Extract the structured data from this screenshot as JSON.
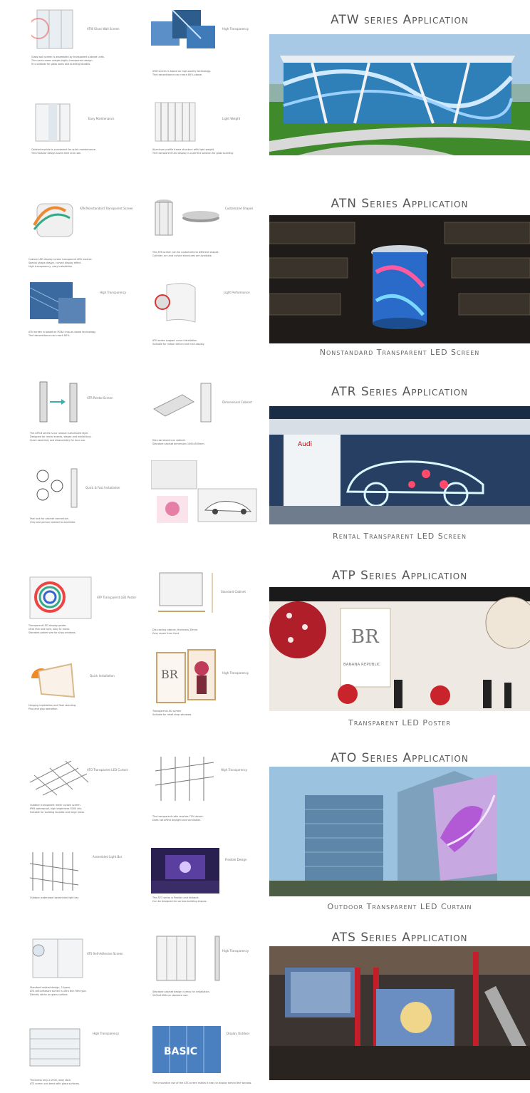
{
  "sections": [
    {
      "id": "atw",
      "title": "ATW series Application",
      "caption": "",
      "features": [
        {
          "tag": "ATW Glass Wall Screen",
          "lines": [
            "Glass wall screen is assembled by transparent cabinet units.",
            "The main screen adopts highly transparent design.",
            "It is suitable for glass walls and building facades."
          ]
        },
        {
          "tag": "High Transparency",
          "lines": [
            "ATW screen is based on high-quality technology.",
            "The transmittance can reach 80% above."
          ]
        },
        {
          "tag": "Easy Maintenance",
          "lines": [
            "Cabinet module is convenient for quick maintenance.",
            "The modular design saves time and cost."
          ]
        },
        {
          "tag": "Light Weight",
          "lines": [
            "Aluminum profile frame structure with light weight.",
            "The transparent LED display is a perfect solution for glass building."
          ]
        }
      ]
    },
    {
      "id": "atn",
      "title": "ATN Series Application",
      "caption": "Nonstandard Transparent LED Screen",
      "features": [
        {
          "tag": "ATN Nonstandard Transparent Screen",
          "lines": [
            "Custom LED display screen transparent LED module.",
            "Special shape design, curved display effect.",
            "High transparency, easy installation."
          ]
        },
        {
          "tag": "Customized Shapes",
          "lines": [
            "The ATN screen can be customized to different shapes.",
            "Cylinder, arc and curved structures are available."
          ]
        },
        {
          "tag": "High Transparency",
          "lines": [
            "ATN screen is based on PCBA chip-on-board technology.",
            "The transmittance can reach 80%."
          ]
        },
        {
          "tag": "Light Performance",
          "lines": [
            "ATN series support curve installation.",
            "Suitable for indoor atrium and mall display."
          ]
        }
      ]
    },
    {
      "id": "atr",
      "title": "ATR Series Application",
      "caption": "Rental Transparent LED Screen",
      "features": [
        {
          "tag": "ATR Rental Screen",
          "lines": [
            "The ATR-B series is our unique customized style.",
            "Designed for rental events, stages and exhibitions.",
            "Quick assembly and disassembly for tour use."
          ]
        },
        {
          "tag": "Dimensional Cabinet",
          "lines": [
            "Die-cast aluminum cabinet.",
            "Standard cabinet dimension 1000x500mm."
          ]
        },
        {
          "tag": "Quick & Fast Installation",
          "lines": [
            "Fast lock for cabinet connection.",
            "Only one person needed to assemble."
          ]
        },
        {
          "tag": "",
          "lines": []
        }
      ]
    },
    {
      "id": "atp",
      "title": "ATP Series Application",
      "caption": "Transparent LED Poster",
      "features": [
        {
          "tag": "ATP Transparent LED Poster",
          "lines": [
            "Transparent LED display poster.",
            "Ultra thin and light, easy to move.",
            "Standard poster size for shop windows."
          ]
        },
        {
          "tag": "Standard Cabinet",
          "lines": [
            "Die-casting cabinet, thickness 30mm.",
            "Easy repair from front."
          ]
        },
        {
          "tag": "Quick Installation",
          "lines": [
            "Hanging installation and floor standing.",
            "Plug and play operation."
          ]
        },
        {
          "tag": "High Transparency",
          "lines": [
            "Transparent LED screen.",
            "Suitable for retail shop windows."
          ]
        }
      ]
    },
    {
      "id": "ato",
      "title": "ATO Series Application",
      "caption": "Outdoor Transparent LED Curtain",
      "features": [
        {
          "tag": "ATO Transparent LED Curtain",
          "lines": [
            "Outdoor transparent mesh curtain screen.",
            "IP65 waterproof, high brightness 5000 nits.",
            "Suitable for building facades and large areas."
          ]
        },
        {
          "tag": "High Transparency",
          "lines": [
            "The transparent ratio reaches 70% above.",
            "Does not affect daylight and ventilation."
          ]
        },
        {
          "tag": "Assembled Light Bar",
          "lines": [
            "Outdoor waterproof assembled light bar."
          ]
        },
        {
          "tag": "Flexible Design",
          "lines": [
            "The ATO series is flexible and foldable.",
            "Can be designed for various building shapes."
          ]
        }
      ]
    },
    {
      "id": "ats",
      "title": "ATS Series Application",
      "caption": "",
      "features": [
        {
          "tag": "ATS Self-Adhesive Screen",
          "lines": [
            "Standard cabinet design, 2 types.",
            "ATS self-adhesive screen is ultra thin film type.",
            "Directly sticks on glass surface."
          ]
        },
        {
          "tag": "High Transparency",
          "lines": [
            "Standard cabinet design is easy for installation.",
            "2000x1000mm standard size."
          ]
        },
        {
          "tag": "High Transparency",
          "lines": [
            "Thickness only 2.0mm, easy stick.",
            "ATS screen can bend with glass surfaces."
          ]
        },
        {
          "tag": "Display Outdoor",
          "lines": [
            "The innovative use of the ATS screen makes it easy to display behind the window."
          ]
        }
      ]
    }
  ],
  "photo_text": {
    "atp_brand": "BANANA REPUBLIC",
    "atr_logo": "Audi",
    "ats_banner": "BASIC"
  },
  "colors": {
    "title": "#555555",
    "caption": "#666666",
    "grass": "#3f8a2b",
    "sky": "#9bc3e0"
  }
}
